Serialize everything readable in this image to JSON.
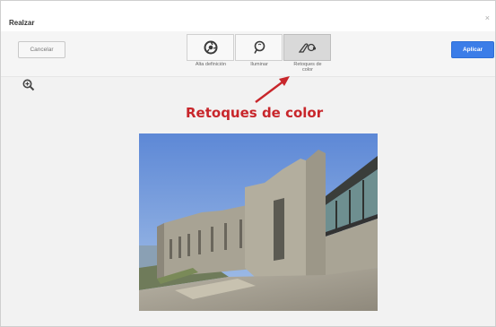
{
  "window": {
    "title": "Realzar",
    "close_symbol": "×"
  },
  "toolbar": {
    "cancel_label": "Cancelar",
    "apply_label": "Aplicar",
    "tools": [
      {
        "icon": "camera-lens-icon",
        "line1": "Alta definición",
        "line2": "",
        "active": false
      },
      {
        "icon": "lightbulb-icon",
        "line1": "Iluminar",
        "line2": "",
        "active": false
      },
      {
        "icon": "color-retouch-icon",
        "line1": "Retoques de",
        "line2": "color",
        "active": true
      }
    ]
  },
  "annotation": {
    "text": "Retoques de color",
    "color": "#c8262b"
  },
  "colors": {
    "apply_bg": "#3b7de8",
    "annotation": "#c8262b",
    "canvas_bg": "#f2f2f2"
  }
}
